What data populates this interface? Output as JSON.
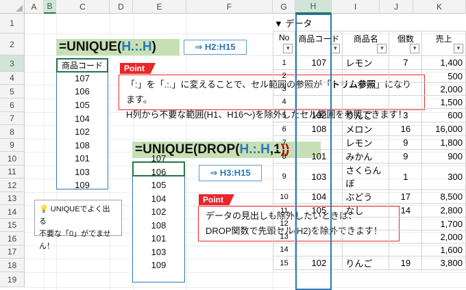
{
  "columns": [
    "A",
    "B",
    "C",
    "D",
    "E",
    "F",
    "G",
    "H",
    "I",
    "J",
    "K"
  ],
  "rows": [
    "1",
    "2",
    "3",
    "4",
    "5",
    "6",
    "7",
    "8",
    "9",
    "10",
    "11",
    "12",
    "13",
    "14",
    "15",
    "16",
    "17",
    "18",
    "19"
  ],
  "formula1": {
    "prefix": "=UNIQUE(",
    "ref": "H.:.H",
    "suffix": ")"
  },
  "arrow1": "⇒ H2:H15",
  "b_header": "商品コード",
  "b_values": [
    "107",
    "106",
    "105",
    "104",
    "102",
    "108",
    "101",
    "103",
    "109"
  ],
  "point1": {
    "tag": "Point",
    "line1_a": "「:」を「.:.」に変えることで、セル範囲の参照が「",
    "line1_b": "トリム参照",
    "line1_c": "」になります。",
    "line2": "H列から不要な範囲(H1、H16～)を除外したセル範囲を参照できます！"
  },
  "formula2": {
    "prefix": "=UNIQUE(DROP(",
    "ref": "H.:.H",
    "suffix1": ",1",
    "suffix2": "))"
  },
  "arrow2": "⇒ H3:H15",
  "d_values": [
    "107",
    "106",
    "105",
    "104",
    "102",
    "108",
    "101",
    "103",
    "109"
  ],
  "tip": {
    "line1": "💡 UNIQUEでよく出る",
    "line2": "不要な「0」がでません！"
  },
  "point2": {
    "tag": "Point",
    "line1": "データの見出しも除外したいときは、",
    "line2": "DROP関数で先頭セル(H2)を除外できます！"
  },
  "table": {
    "title": "▼ データ",
    "headers": [
      "No",
      "商品コード",
      "商品名",
      "個数",
      "売上"
    ],
    "rows": [
      [
        "1",
        "107",
        "レモン",
        "7",
        "1,400"
      ],
      [
        "2",
        "",
        "",
        "",
        "500"
      ],
      [
        "3",
        "",
        "",
        "",
        "2,000"
      ],
      [
        "4",
        "",
        "",
        "",
        "1,500"
      ],
      [
        "5",
        "102",
        "りんご",
        "3",
        "600"
      ],
      [
        "6",
        "108",
        "メロン",
        "16",
        "16,000"
      ],
      [
        "7",
        "",
        "レモン",
        "9",
        "1,800"
      ],
      [
        "8",
        "101",
        "みかん",
        "9",
        "900"
      ],
      [
        "9",
        "103",
        "さくらんぼ",
        "1",
        "300"
      ],
      [
        "10",
        "104",
        "ぶどう",
        "17",
        "8,500"
      ],
      [
        "11",
        "105",
        "なし",
        "14",
        "2,800"
      ],
      [
        "12",
        "",
        "",
        "",
        "1,700"
      ],
      [
        "13",
        "",
        "",
        "",
        "2,000"
      ],
      [
        "14",
        "",
        "",
        "",
        "1,600"
      ],
      [
        "15",
        "102",
        "りんご",
        "19",
        "3,800"
      ]
    ]
  }
}
